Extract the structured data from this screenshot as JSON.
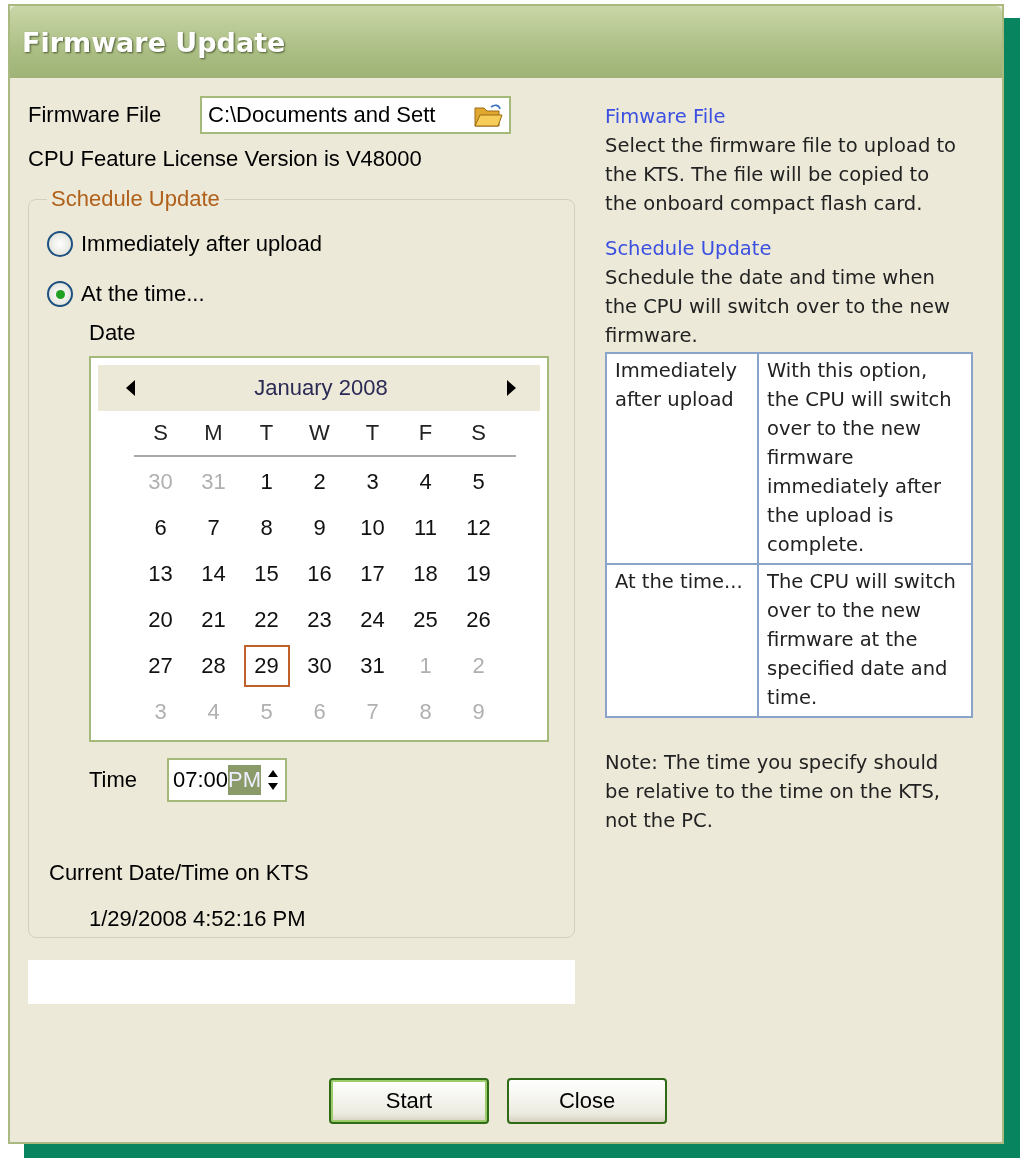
{
  "window": {
    "title": "Firmware Update"
  },
  "firmware_file": {
    "label": "Firmware File",
    "value": "C:\\Documents and Sett"
  },
  "license_text": "CPU Feature License Version is V48000",
  "schedule": {
    "legend": "Schedule Update",
    "options": [
      {
        "label": "Immediately after upload",
        "selected": false
      },
      {
        "label": "At the time...",
        "selected": true
      }
    ],
    "date_label": "Date",
    "calendar": {
      "month": "January 2008",
      "weekdays": [
        "S",
        "M",
        "T",
        "W",
        "T",
        "F",
        "S"
      ],
      "weeks": [
        [
          {
            "day": "30",
            "other_month": true,
            "selected": false
          },
          {
            "day": "31",
            "other_month": true,
            "selected": false
          },
          {
            "day": "1",
            "other_month": false,
            "selected": false
          },
          {
            "day": "2",
            "other_month": false,
            "selected": false
          },
          {
            "day": "3",
            "other_month": false,
            "selected": false
          },
          {
            "day": "4",
            "other_month": false,
            "selected": false
          },
          {
            "day": "5",
            "other_month": false,
            "selected": false
          }
        ],
        [
          {
            "day": "6",
            "other_month": false,
            "selected": false
          },
          {
            "day": "7",
            "other_month": false,
            "selected": false
          },
          {
            "day": "8",
            "other_month": false,
            "selected": false
          },
          {
            "day": "9",
            "other_month": false,
            "selected": false
          },
          {
            "day": "10",
            "other_month": false,
            "selected": false
          },
          {
            "day": "11",
            "other_month": false,
            "selected": false
          },
          {
            "day": "12",
            "other_month": false,
            "selected": false
          }
        ],
        [
          {
            "day": "13",
            "other_month": false,
            "selected": false
          },
          {
            "day": "14",
            "other_month": false,
            "selected": false
          },
          {
            "day": "15",
            "other_month": false,
            "selected": false
          },
          {
            "day": "16",
            "other_month": false,
            "selected": false
          },
          {
            "day": "17",
            "other_month": false,
            "selected": false
          },
          {
            "day": "18",
            "other_month": false,
            "selected": false
          },
          {
            "day": "19",
            "other_month": false,
            "selected": false
          }
        ],
        [
          {
            "day": "20",
            "other_month": false,
            "selected": false
          },
          {
            "day": "21",
            "other_month": false,
            "selected": false
          },
          {
            "day": "22",
            "other_month": false,
            "selected": false
          },
          {
            "day": "23",
            "other_month": false,
            "selected": false
          },
          {
            "day": "24",
            "other_month": false,
            "selected": false
          },
          {
            "day": "25",
            "other_month": false,
            "selected": false
          },
          {
            "day": "26",
            "other_month": false,
            "selected": false
          }
        ],
        [
          {
            "day": "27",
            "other_month": false,
            "selected": false
          },
          {
            "day": "28",
            "other_month": false,
            "selected": false
          },
          {
            "day": "29",
            "other_month": false,
            "selected": true
          },
          {
            "day": "30",
            "other_month": false,
            "selected": false
          },
          {
            "day": "31",
            "other_month": false,
            "selected": false
          },
          {
            "day": "1",
            "other_month": true,
            "selected": false
          },
          {
            "day": "2",
            "other_month": true,
            "selected": false
          }
        ],
        [
          {
            "day": "3",
            "other_month": true,
            "selected": false
          },
          {
            "day": "4",
            "other_month": true,
            "selected": false
          },
          {
            "day": "5",
            "other_month": true,
            "selected": false
          },
          {
            "day": "6",
            "other_month": true,
            "selected": false
          },
          {
            "day": "7",
            "other_month": true,
            "selected": false
          },
          {
            "day": "8",
            "other_month": true,
            "selected": false
          },
          {
            "day": "9",
            "other_month": true,
            "selected": false
          }
        ]
      ]
    },
    "time_label": "Time",
    "time_segments": [
      {
        "text": "07:00",
        "selected": false
      },
      {
        "text": "PM",
        "selected": true
      }
    ],
    "current_label": "Current Date/Time on KTS",
    "current_value": "1/29/2008 4:52:16 PM"
  },
  "help": {
    "sections": [
      {
        "heading": "Fimware File",
        "text": "Select the firmware file to upload to the KTS. The file will be copied to the onboard compact flash card."
      },
      {
        "heading": "Schedule Update",
        "text": "Schedule the date and time when the CPU will switch over to the new firmware."
      }
    ],
    "table": [
      {
        "option": "Immediately after upload",
        "description": "With this option, the CPU will switch over to the new firmware immediately after the upload is complete."
      },
      {
        "option": "At the time...",
        "description": "The CPU will switch over to the new firmware at the specified date and time."
      }
    ],
    "note": "Note: The time you specify should be relative to the time on the KTS, not the PC."
  },
  "buttons": [
    {
      "label": "Start",
      "default": true
    },
    {
      "label": "Close",
      "default": false
    }
  ]
}
